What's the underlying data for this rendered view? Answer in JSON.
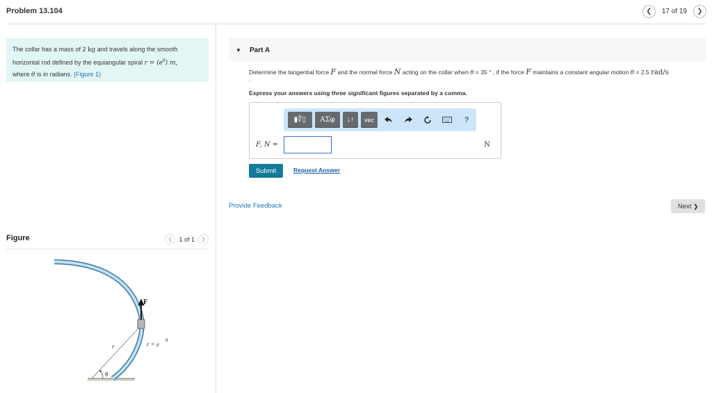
{
  "header": {
    "title": "Problem 13.104",
    "pager": {
      "prev_icon": "chevron-left-icon",
      "text": "17 of 19",
      "next_icon": "chevron-right-icon"
    }
  },
  "problem": {
    "text_part1": "The collar has a mass of 2 ",
    "mass_unit": "kg",
    "text_part2": " and travels along the smooth",
    "text_line2": "horizontal rod defined by the equiangular spiral ",
    "formula": "r = (e",
    "formula_exp": "θ",
    "formula_close": ") m,",
    "text_line3_a": "where ",
    "theta": "θ",
    "text_line3_b": " is in radians. ",
    "figure_link": "(Figure 1)"
  },
  "figure": {
    "title": "Figure",
    "pager_text": "1 of 1",
    "labels": {
      "force": "F",
      "radius": "r",
      "angle": "θ",
      "equation": "r = e",
      "equation_exp": "θ"
    }
  },
  "part_a": {
    "title": "Part A",
    "question": {
      "a": "Determine the tangential force ",
      "F": "F",
      "b": " and the normal force ",
      "N": "N",
      "c": " acting on the collar when ",
      "theta": "θ",
      "d": " = 35 ° , if the force ",
      "F2": "F",
      "e": " maintains a constant angular motion ",
      "thetadot": "θ̇",
      "f": " = 2.5 ",
      "unit": "rad/s"
    },
    "dot": ".",
    "instruction": "Express your answers using three significant figures separated by a comma.",
    "toolbar": {
      "templates_label": "▮∜▯",
      "greek_label": "ΑΣφ",
      "arrows_label": "↓↑",
      "vec_label": "vec",
      "undo_icon": "undo-icon",
      "redo_icon": "redo-icon",
      "reset_icon": "reset-icon",
      "keyboard_icon": "keyboard-icon",
      "help_label": "?"
    },
    "answer_label": "F, N =",
    "answer_value": "",
    "answer_unit": "N",
    "submit_label": "Submit",
    "request_answer_label": "Request Answer"
  },
  "footer": {
    "feedback_label": "Provide Feedback",
    "next_label": "Next",
    "next_icon": "❯"
  }
}
